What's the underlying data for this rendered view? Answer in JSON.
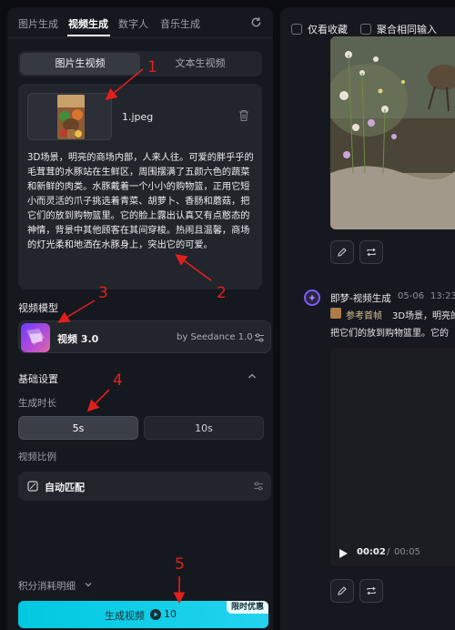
{
  "top_tabs": [
    {
      "label": "图片生成",
      "active": false
    },
    {
      "label": "视频生成",
      "active": true
    },
    {
      "label": "数字人",
      "active": false
    },
    {
      "label": "音乐生成",
      "active": false
    }
  ],
  "mode_tabs": [
    {
      "label": "图片生视频",
      "active": true
    },
    {
      "label": "文本生视频",
      "active": false
    }
  ],
  "upload": {
    "file_name": "1.jpeg"
  },
  "prompt_text": "3D场景，明亮的商场内部，人来人往。可爱的胖乎乎的毛茸茸的水豚站在生鲜区，周围摆满了五颜六色的蔬菜和新鲜的肉类。水豚戴着一个小小的购物篮，正用它短小而灵活的爪子挑选着青菜、胡萝卜、香肠和蘑菇，把它们的放到购物篮里。它的脸上露出认真又有点憨态的神情，背景中其他顾客在其间穿梭。热闹且温馨，商场的灯光柔和地洒在水豚身上，突出它的可爱。",
  "model_section": {
    "title": "视频模型",
    "model_name": "视频 3.0",
    "provider": "by Seedance 1.0"
  },
  "basic_settings": {
    "title": "基础设置",
    "duration_label": "生成时长",
    "durations": [
      {
        "label": "5s",
        "active": true
      },
      {
        "label": "10s",
        "active": false
      }
    ],
    "ratio_label": "视频比例",
    "ratio_value": "自动匹配"
  },
  "credits_detail": "积分消耗明细",
  "generate": {
    "label": "生成视频",
    "cost": "10",
    "promo": "限时优惠"
  },
  "annotations": [
    "1",
    "2",
    "3",
    "4",
    "5"
  ],
  "right_panel": {
    "checkbox_favorites": "仅看收藏",
    "checkbox_merge": "聚合相同输入",
    "task": {
      "app_name": "即梦-视频生成",
      "date": "05-06",
      "time": "13:23",
      "ref_tag": "参考首帧",
      "prompt_line1": "3D场景，明亮的",
      "prompt_line2": "把它们的放到购物篮里。它的"
    },
    "video": {
      "current": "00:02",
      "separator": "/",
      "total": "00:05"
    }
  },
  "colors": {
    "accent": "#22d3ee",
    "annotation": "#e0201d",
    "panel": "#16181f"
  }
}
